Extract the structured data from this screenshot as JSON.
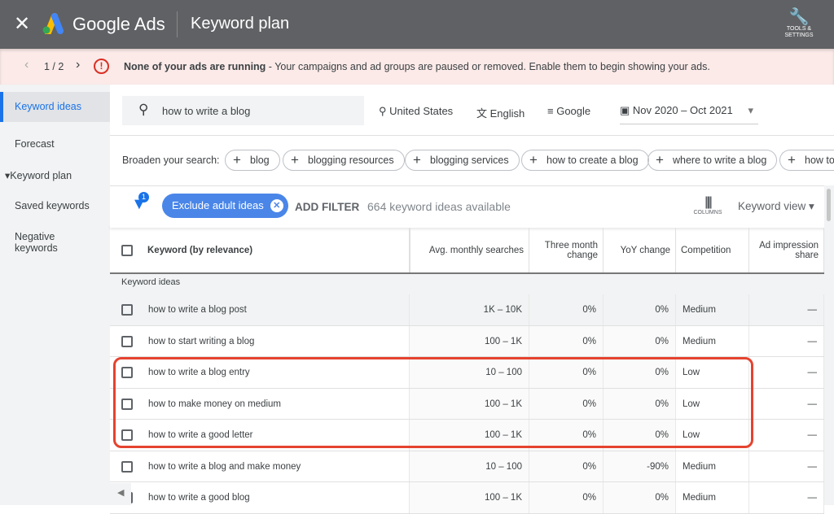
{
  "header": {
    "brand": "Google Ads",
    "title": "Keyword plan",
    "tools_label": "TOOLS & SETTINGS"
  },
  "alert": {
    "pager": "1 / 2",
    "bold": "None of your ads are running",
    "message": " - Your campaigns and ad groups are paused or removed. Enable them to begin showing your ads."
  },
  "sidebar": {
    "items": [
      {
        "label": "Keyword ideas"
      },
      {
        "label": "Forecast"
      },
      {
        "label": "Keyword plan"
      },
      {
        "label": "Saved keywords"
      },
      {
        "label": "Negative keywords"
      }
    ]
  },
  "search": {
    "query": "how to write a blog",
    "location": "United States",
    "language": "English",
    "network": "Google",
    "date_range": "Nov 2020 – Oct 2021"
  },
  "broaden": {
    "label": "Broaden your search:",
    "chips": [
      "blog",
      "blogging resources",
      "blogging services",
      "how to create a blog",
      "where to write a blog",
      "how to"
    ]
  },
  "filters": {
    "badge": "1",
    "chip": "Exclude adult ideas",
    "add_filter": "ADD FILTER",
    "count": "664 keyword ideas available",
    "columns": "COLUMNS",
    "view": "Keyword view"
  },
  "table": {
    "headers": [
      "Keyword (by relevance)",
      "Avg. monthly searches",
      "Three month change",
      "YoY change",
      "Competition",
      "Ad impression share"
    ],
    "group": "Keyword ideas",
    "rows": [
      [
        "how to write a blog post",
        "1K – 10K",
        "0%",
        "0%",
        "Medium",
        "—"
      ],
      [
        "how to start writing a blog",
        "100 – 1K",
        "0%",
        "0%",
        "Medium",
        "—"
      ],
      [
        "how to write a blog entry",
        "10 – 100",
        "0%",
        "0%",
        "Low",
        "—"
      ],
      [
        "how to make money on medium",
        "100 – 1K",
        "0%",
        "0%",
        "Low",
        "—"
      ],
      [
        "how to write a good letter",
        "100 – 1K",
        "0%",
        "0%",
        "Low",
        "—"
      ],
      [
        "how to write a blog and make money",
        "10 – 100",
        "0%",
        "-90%",
        "Medium",
        "—"
      ],
      [
        "how to write a good blog",
        "100 – 1K",
        "0%",
        "0%",
        "Medium",
        "—"
      ]
    ]
  },
  "colors": {
    "header": "#5f6164",
    "accent": "#1a73e8",
    "highlight": "#e5432f",
    "alert_bg": "#fbeae8"
  }
}
